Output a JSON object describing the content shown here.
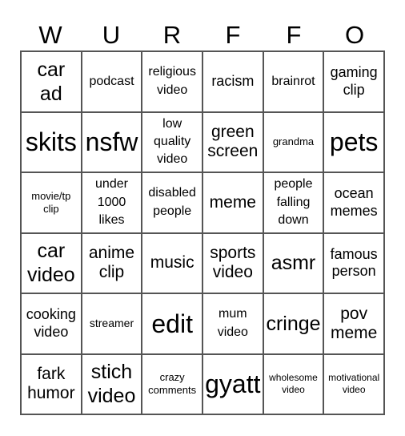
{
  "header": [
    "W",
    "U",
    "R",
    "F",
    "F",
    "O"
  ],
  "rows": [
    [
      "car ad",
      "podcast",
      "religious video",
      "racism",
      "brainrot",
      "gaming clip"
    ],
    [
      "skits",
      "nsfw",
      "low quality video",
      "green screen",
      "grandma",
      "pets"
    ],
    [
      "movie/tp clip",
      "under 1000 likes",
      "disabled people",
      "meme",
      "people falling down",
      "ocean memes"
    ],
    [
      "car video",
      "anime clip",
      "music",
      "sports video",
      "asmr",
      "famous person"
    ],
    [
      "cooking video",
      "streamer",
      "edit",
      "mum video",
      "cringe",
      "pov meme"
    ],
    [
      "fark humor",
      "stich video",
      "crazy comments",
      "gyatt",
      "wholesome video",
      "motivational video"
    ]
  ]
}
